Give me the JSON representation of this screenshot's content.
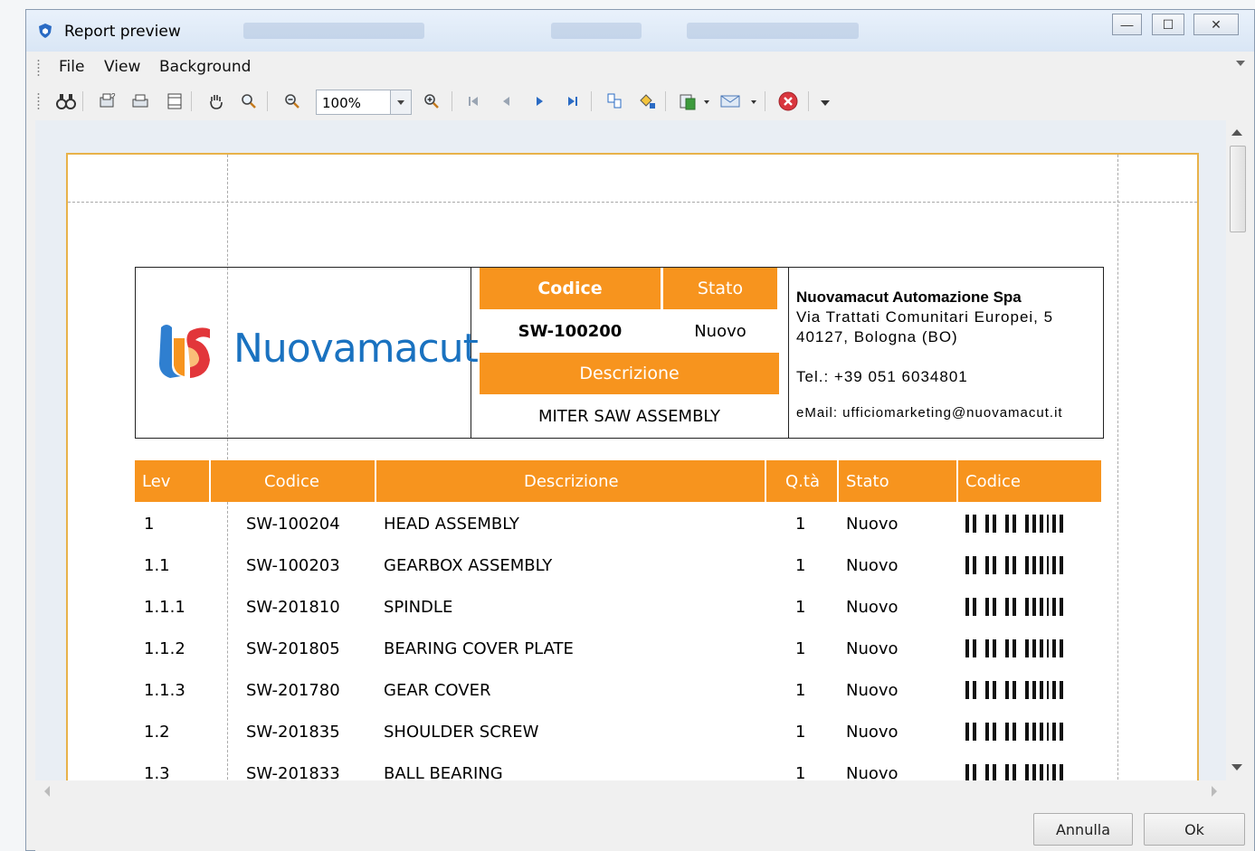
{
  "window": {
    "title": "Report preview",
    "controls": {
      "minimize": "—",
      "maximize": "☐",
      "close": "✕"
    }
  },
  "menu": [
    "File",
    "View",
    "Background"
  ],
  "toolbar": {
    "zoom_value": "100%",
    "icons": [
      "search-binoculars-icon",
      "page-setup-icon",
      "print-icon",
      "print-quick-icon",
      "hand-tool-icon",
      "magnifier-icon",
      "zoom-out-icon",
      "zoom-in-icon",
      "first-page-icon",
      "previous-page-icon",
      "next-page-icon",
      "last-page-icon",
      "multiple-pages-icon",
      "background-color-icon",
      "export-icon",
      "send-email-icon",
      "close-preview-icon"
    ]
  },
  "report": {
    "logo_text": "Nuovamacut",
    "header": {
      "codice_label": "Codice",
      "stato_label": "Stato",
      "codice_value": "SW-100200",
      "stato_value": "Nuovo",
      "descrizione_label": "Descrizione",
      "descrizione_value": "MITER SAW ASSEMBLY"
    },
    "company": {
      "name": "Nuovamacut Automazione Spa",
      "address1": "Via Trattati Comunitari Europei, 5",
      "address2": "40127, Bologna (BO)",
      "phone": "Tel.: +39 051 6034801",
      "email": "eMail: ufficiomarketing@nuovamacut.it"
    },
    "columns": [
      "Lev",
      "Codice",
      "Descrizione",
      "Q.tà",
      "Stato",
      "Codice"
    ],
    "rows": [
      {
        "lev": "1",
        "codice": "SW-100204",
        "descrizione": "HEAD ASSEMBLY",
        "qta": "1",
        "stato": "Nuovo"
      },
      {
        "lev": "1.1",
        "codice": "SW-100203",
        "descrizione": "GEARBOX ASSEMBLY",
        "qta": "1",
        "stato": "Nuovo"
      },
      {
        "lev": "1.1.1",
        "codice": "SW-201810",
        "descrizione": "SPINDLE",
        "qta": "1",
        "stato": "Nuovo"
      },
      {
        "lev": "1.1.2",
        "codice": "SW-201805",
        "descrizione": "BEARING COVER PLATE",
        "qta": "1",
        "stato": "Nuovo"
      },
      {
        "lev": "1.1.3",
        "codice": "SW-201780",
        "descrizione": "GEAR COVER",
        "qta": "1",
        "stato": "Nuovo"
      },
      {
        "lev": "1.2",
        "codice": "SW-201835",
        "descrizione": "SHOULDER SCREW",
        "qta": "1",
        "stato": "Nuovo"
      },
      {
        "lev": "1.3",
        "codice": "SW-201833",
        "descrizione": "BALL BEARING",
        "qta": "1",
        "stato": "Nuovo"
      }
    ]
  },
  "buttons": {
    "cancel": "Annulla",
    "ok": "Ok"
  },
  "colors": {
    "accent": "#f7941e",
    "logo_blue": "#1a72c0",
    "page_border": "#e8b24a"
  }
}
